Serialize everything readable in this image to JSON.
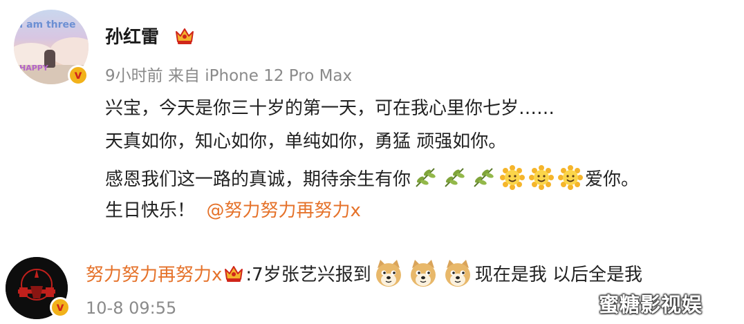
{
  "post": {
    "avatar_text_top": "I am three",
    "avatar_text_bottom": "HAPPY",
    "author": "孙红雷",
    "meta": "9小时前  来自 iPhone 12 Pro Max",
    "lines": [
      "兴宝，今天是你三十岁的第一天，可在我心里你七岁……",
      "天真如你，知心如你，单纯如你，勇猛 顽强如你。",
      "感恩我们这一路的真诚，期待余生有你",
      "爱你。",
      "生日快乐！"
    ],
    "mention": "@努力努力再努力x",
    "emojis": [
      "olive-branch",
      "olive-branch",
      "olive-branch",
      "sun-face",
      "sun-face",
      "sun-face"
    ]
  },
  "reply": {
    "author": "努力努力再努力x",
    "text_before": ":7岁张艺兴报到",
    "text_after": "现在是我 以后全是我",
    "time": "10-8 09:55",
    "emojis": [
      "doge",
      "doge",
      "doge"
    ]
  },
  "badge_letter": "v",
  "watermark": "蜜糖影视娱",
  "colors": {
    "accent": "#e5722a",
    "meta_gray": "#8a8a8a",
    "badge": "#f2b21a"
  }
}
